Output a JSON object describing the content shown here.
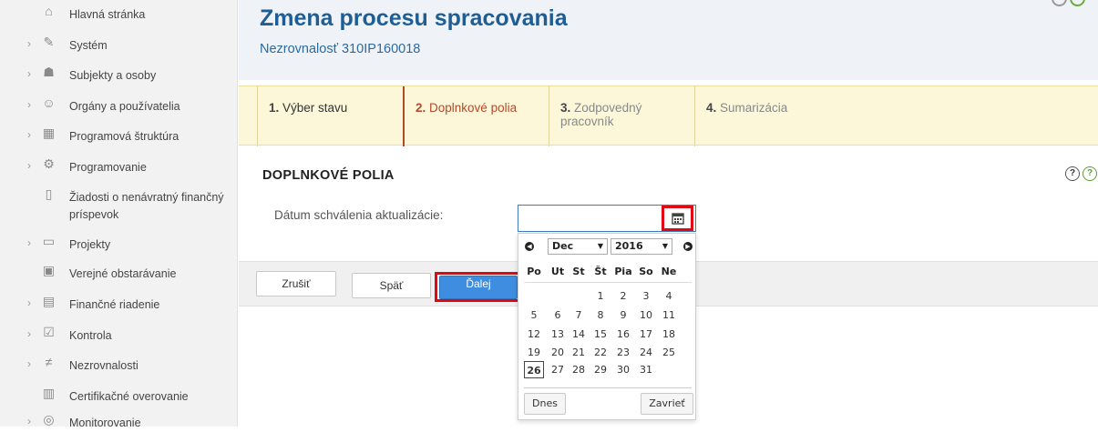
{
  "sidebar": {
    "items": [
      {
        "label": "Hlavná stránka",
        "icon": "home-icon",
        "chevron": false
      },
      {
        "label": "Systém",
        "icon": "wrench-icon",
        "chevron": true
      },
      {
        "label": "Subjekty a osoby",
        "icon": "people-icon",
        "chevron": true
      },
      {
        "label": "Orgány a používatelia",
        "icon": "users-icon",
        "chevron": true
      },
      {
        "label": "Programová štruktúra",
        "icon": "structure-icon",
        "chevron": true
      },
      {
        "label": "Programovanie",
        "icon": "gear-icon",
        "chevron": true
      },
      {
        "label": "Žiadosti o nenávratný finančný",
        "label2": "príspevok",
        "icon": "document-icon",
        "chevron": false
      },
      {
        "label": "Projekty",
        "icon": "folder-icon",
        "chevron": true
      },
      {
        "label": "Verejné obstarávanie",
        "icon": "box-icon",
        "chevron": false
      },
      {
        "label": "Finančné riadenie",
        "icon": "finance-icon",
        "chevron": true
      },
      {
        "label": "Kontrola",
        "icon": "checklist-icon",
        "chevron": true
      },
      {
        "label": "Nezrovnalosti",
        "icon": "not-equal-icon",
        "chevron": true
      },
      {
        "label": "Certifikačné overovanie",
        "icon": "certificate-icon",
        "chevron": false
      },
      {
        "label": "Monitorovanie",
        "icon": "monitor-icon",
        "chevron": true
      }
    ]
  },
  "header": {
    "title": "Zmena procesu spracovania",
    "subtitle": "Nezrovnalosť 310IP160018"
  },
  "steps": [
    {
      "num": "1.",
      "label": "Výber stavu"
    },
    {
      "num": "2.",
      "label": "Doplnkové polia"
    },
    {
      "num": "3.",
      "label": "Zodpovedný",
      "label2": "pracovník"
    },
    {
      "num": "4.",
      "label": "Sumarizácia"
    }
  ],
  "form": {
    "section_title": "DOPLNKOVÉ POLIA",
    "date_label": "Dátum schválenia aktualizácie:",
    "date_value": ""
  },
  "buttons": {
    "cancel": "Zrušiť",
    "back": "Späť",
    "next": "Ďalej"
  },
  "datepicker": {
    "month": "Dec",
    "year": "2016",
    "weekdays": [
      "Po",
      "Ut",
      "St",
      "Št",
      "Pia",
      "So",
      "Ne"
    ],
    "weeks": [
      [
        "",
        "",
        "",
        "1",
        "2",
        "3",
        "4"
      ],
      [
        "5",
        "6",
        "7",
        "8",
        "9",
        "10",
        "11"
      ],
      [
        "12",
        "13",
        "14",
        "15",
        "16",
        "17",
        "18"
      ],
      [
        "19",
        "20",
        "21",
        "22",
        "23",
        "24",
        "25"
      ],
      [
        "26",
        "27",
        "28",
        "29",
        "30",
        "31",
        ""
      ]
    ],
    "today": "26",
    "today_button": "Dnes",
    "close_button": "Zavrieť"
  },
  "colors": {
    "accent": "#1f5e94",
    "active_step": "#b44a2a",
    "primary_button": "#3f8de0",
    "highlight_frame": "#e30613"
  }
}
